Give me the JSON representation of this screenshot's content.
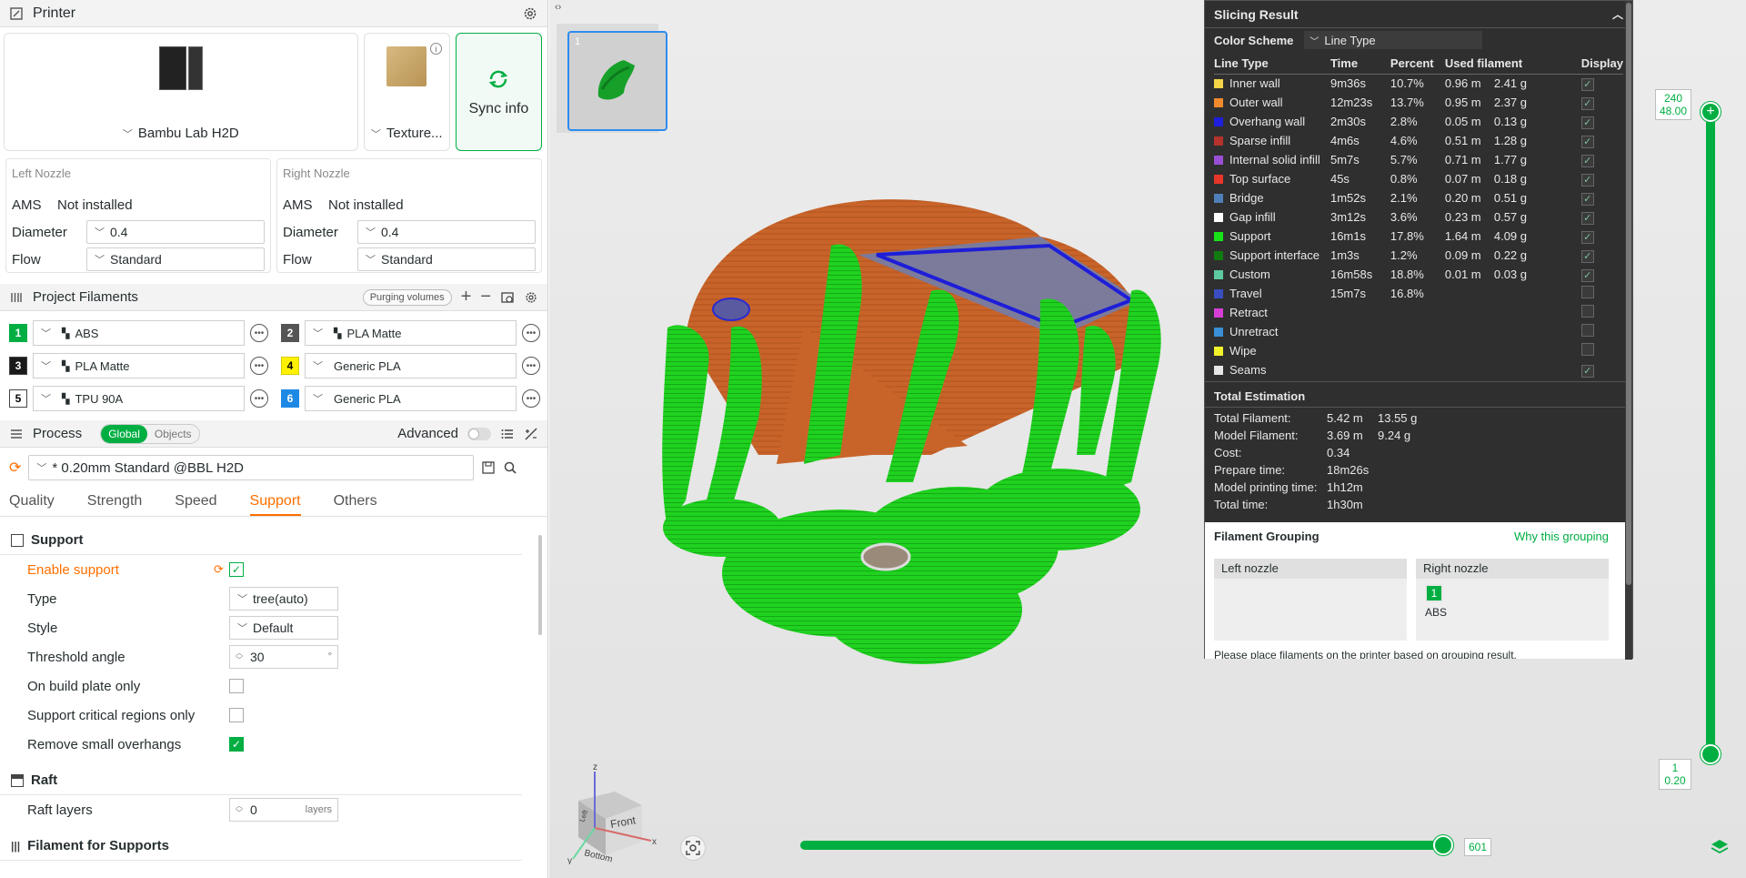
{
  "printer": {
    "header_title": "Printer",
    "printer_name": "Bambu Lab H2D",
    "plate_name": "Texture...",
    "sync_label": "Sync info",
    "left_nozzle": {
      "title": "Left Nozzle",
      "ams_label": "AMS",
      "ams_value": "Not installed",
      "diameter_label": "Diameter",
      "diameter_value": "0.4",
      "flow_label": "Flow",
      "flow_value": "Standard"
    },
    "right_nozzle": {
      "title": "Right Nozzle",
      "ams_label": "AMS",
      "ams_value": "Not installed",
      "diameter_label": "Diameter",
      "diameter_value": "0.4",
      "flow_label": "Flow",
      "flow_value": "Standard"
    }
  },
  "project_filaments": {
    "title": "Project Filaments",
    "purging_label": "Purging volumes",
    "items": [
      {
        "num": "1",
        "name": "ABS",
        "color": "#00ae42",
        "text_color": "#ffffff"
      },
      {
        "num": "2",
        "name": "PLA Matte",
        "color": "#555555",
        "text_color": "#ffffff"
      },
      {
        "num": "3",
        "name": "PLA Matte",
        "color": "#1a1a1a",
        "text_color": "#ffffff"
      },
      {
        "num": "4",
        "name": "Generic PLA",
        "color": "#fff200",
        "text_color": "#000000"
      },
      {
        "num": "5",
        "name": "TPU 90A",
        "color": "#ffffff",
        "text_color": "#000000"
      },
      {
        "num": "6",
        "name": "Generic PLA",
        "color": "#1e88e5",
        "text_color": "#ffffff"
      }
    ]
  },
  "process": {
    "title": "Process",
    "global_label": "Global",
    "objects_label": "Objects",
    "advanced_label": "Advanced",
    "preset": "* 0.20mm Standard @BBL H2D",
    "tabs": [
      "Quality",
      "Strength",
      "Speed",
      "Support",
      "Others"
    ],
    "active_tab": "Support",
    "support_section": "Support",
    "enable_support_label": "Enable support",
    "type_label": "Type",
    "type_value": "tree(auto)",
    "style_label": "Style",
    "style_value": "Default",
    "threshold_label": "Threshold angle",
    "threshold_value": "30",
    "threshold_unit": "°",
    "build_plate_only_label": "On build plate only",
    "critical_regions_label": "Support critical regions only",
    "remove_overhangs_label": "Remove small overhangs",
    "raft_section": "Raft",
    "raft_layers_label": "Raft layers",
    "raft_layers_value": "0",
    "raft_layers_unit": "layers",
    "filament_supports_section": "Filament for Supports"
  },
  "plate": {
    "index": "1"
  },
  "slicing": {
    "title": "Slicing Result",
    "color_scheme_label": "Color Scheme",
    "color_scheme_value": "Line Type",
    "columns": [
      "Line Type",
      "Time",
      "Percent",
      "Used filament",
      "Display"
    ],
    "rows": [
      {
        "name": "Inner wall",
        "color": "#f5d445",
        "time": "9m36s",
        "percent": "10.7%",
        "len": "0.96 m",
        "weight": "2.41 g",
        "display": true
      },
      {
        "name": "Outer wall",
        "color": "#f08a2c",
        "time": "12m23s",
        "percent": "13.7%",
        "len": "0.95 m",
        "weight": "2.37 g",
        "display": true
      },
      {
        "name": "Overhang wall",
        "color": "#1e1edc",
        "time": "2m30s",
        "percent": "2.8%",
        "len": "0.05 m",
        "weight": "0.13 g",
        "display": true
      },
      {
        "name": "Sparse infill",
        "color": "#b5332b",
        "time": "4m6s",
        "percent": "4.6%",
        "len": "0.51 m",
        "weight": "1.28 g",
        "display": true
      },
      {
        "name": "Internal solid infill",
        "color": "#9a4fd6",
        "time": "5m7s",
        "percent": "5.7%",
        "len": "0.71 m",
        "weight": "1.77 g",
        "display": true
      },
      {
        "name": "Top surface",
        "color": "#e8362a",
        "time": "45s",
        "percent": "0.8%",
        "len": "0.07 m",
        "weight": "0.18 g",
        "display": true
      },
      {
        "name": "Bridge",
        "color": "#4f7fb8",
        "time": "1m52s",
        "percent": "2.1%",
        "len": "0.20 m",
        "weight": "0.51 g",
        "display": true
      },
      {
        "name": "Gap infill",
        "color": "#ffffff",
        "time": "3m12s",
        "percent": "3.6%",
        "len": "0.23 m",
        "weight": "0.57 g",
        "display": true
      },
      {
        "name": "Support",
        "color": "#18e318",
        "time": "16m1s",
        "percent": "17.8%",
        "len": "1.64 m",
        "weight": "4.09 g",
        "display": true
      },
      {
        "name": "Support interface",
        "color": "#117a11",
        "time": "1m3s",
        "percent": "1.2%",
        "len": "0.09 m",
        "weight": "0.22 g",
        "display": true
      },
      {
        "name": "Custom",
        "color": "#5dc9a0",
        "time": "16m58s",
        "percent": "18.8%",
        "len": "0.01 m",
        "weight": "0.03 g",
        "display": true
      },
      {
        "name": "Travel",
        "color": "#3a4ec2",
        "time": "15m7s",
        "percent": "16.8%",
        "len": "",
        "weight": "",
        "display": false
      },
      {
        "name": "Retract",
        "color": "#d63fd6",
        "time": "",
        "percent": "",
        "len": "",
        "weight": "",
        "display": false
      },
      {
        "name": "Unretract",
        "color": "#3a8fd6",
        "time": "",
        "percent": "",
        "len": "",
        "weight": "",
        "display": false
      },
      {
        "name": "Wipe",
        "color": "#f2f22a",
        "time": "",
        "percent": "",
        "len": "",
        "weight": "",
        "display": false
      },
      {
        "name": "Seams",
        "color": "#e6e6e6",
        "time": "",
        "percent": "",
        "len": "",
        "weight": "",
        "display": true
      }
    ],
    "total_title": "Total Estimation",
    "totals": [
      {
        "label": "Total Filament:",
        "v1": "5.42 m",
        "v2": "13.55 g"
      },
      {
        "label": "Model Filament:",
        "v1": "3.69 m",
        "v2": "9.24 g"
      },
      {
        "label": "Cost:",
        "v1": "0.34",
        "v2": ""
      },
      {
        "label": "Prepare time:",
        "v1": "18m26s",
        "v2": ""
      },
      {
        "label": "Model printing time:",
        "v1": "1h12m",
        "v2": ""
      },
      {
        "label": "Total time:",
        "v1": "1h30m",
        "v2": ""
      }
    ],
    "grouping_title": "Filament Grouping",
    "grouping_link": "Why this grouping",
    "left_nozzle_label": "Left nozzle",
    "right_nozzle_label": "Right nozzle",
    "right_nozzle_filament_num": "1",
    "right_nozzle_filament_name": "ABS",
    "grouping_note": "Please place filaments on the printer based on grouping result."
  },
  "layer_slider": {
    "top_layer": "240",
    "top_height": "48.00",
    "bottom_layer": "1",
    "bottom_height": "0.20"
  },
  "move_slider": {
    "value": "601"
  },
  "nav_cube": {
    "front": "Front",
    "bottom": "Bottom",
    "left": "Left",
    "x": "x",
    "y": "y",
    "z": "z"
  }
}
